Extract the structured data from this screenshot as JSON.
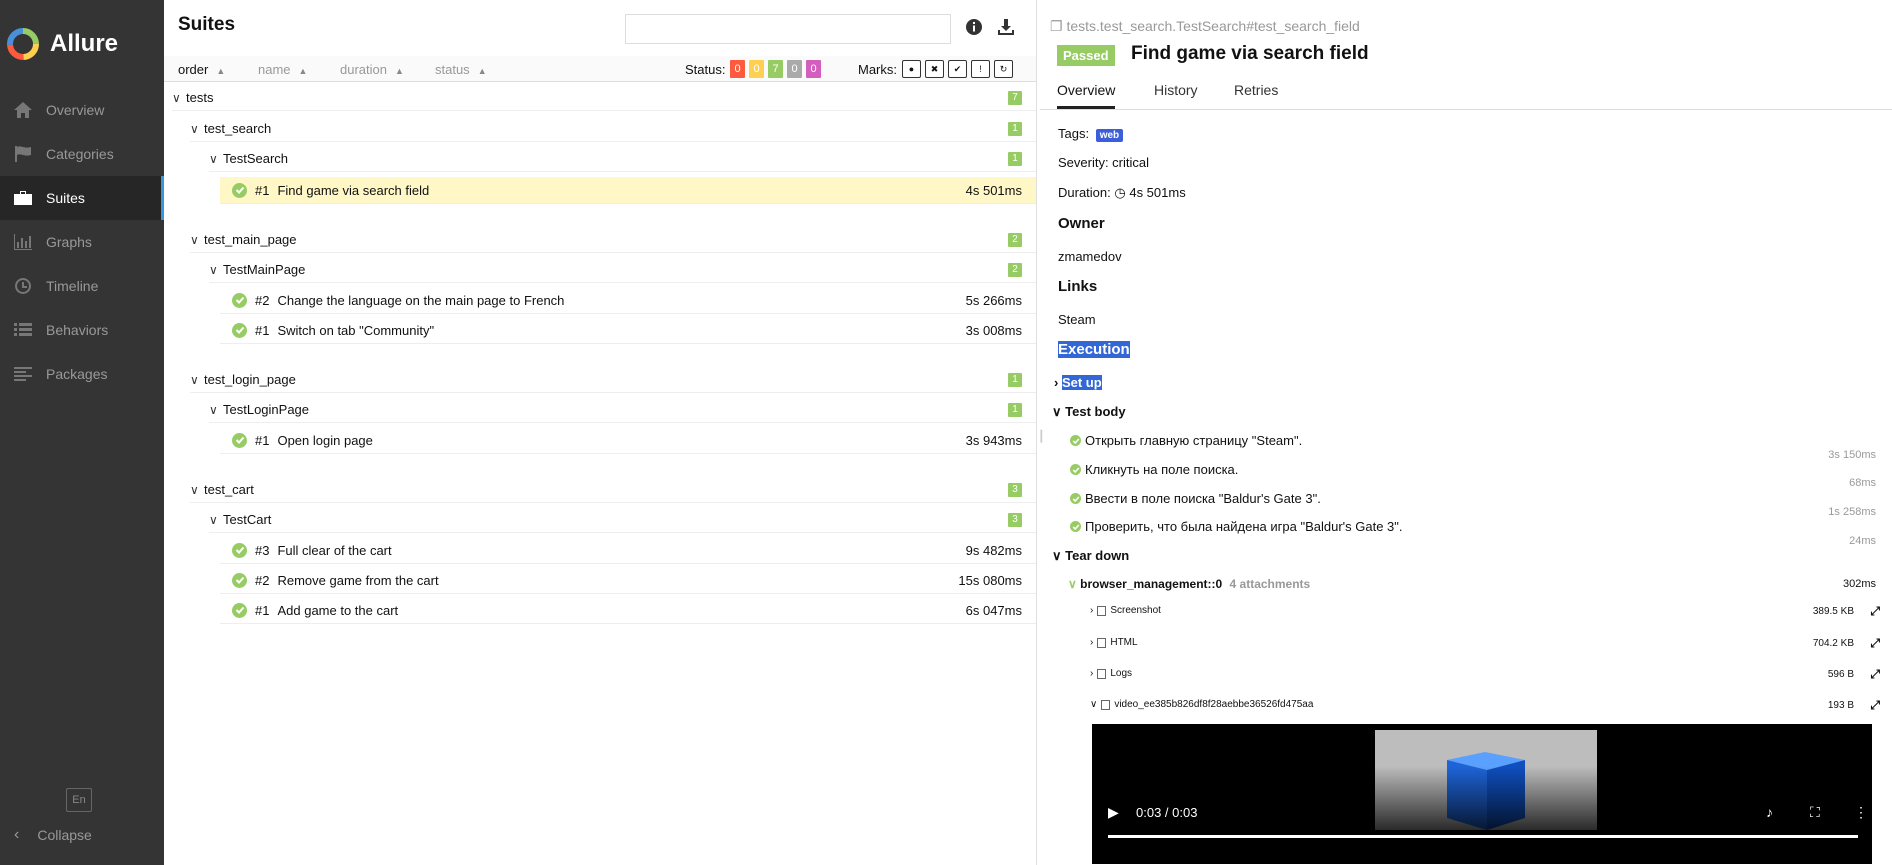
{
  "app": {
    "name": "Allure"
  },
  "sidebar": {
    "items": [
      {
        "label": "Overview",
        "icon": "home-icon"
      },
      {
        "label": "Categories",
        "icon": "flag-icon"
      },
      {
        "label": "Suites",
        "icon": "briefcase-icon",
        "active": true
      },
      {
        "label": "Graphs",
        "icon": "bar-chart-icon"
      },
      {
        "label": "Timeline",
        "icon": "clock-icon"
      },
      {
        "label": "Behaviors",
        "icon": "list-icon"
      },
      {
        "label": "Packages",
        "icon": "align-left-icon"
      }
    ],
    "language": "En",
    "collapse": "Collapse"
  },
  "suites": {
    "title": "Suites",
    "search_placeholder": "",
    "sort": [
      "order",
      "name",
      "duration",
      "status"
    ],
    "status_label": "Status:",
    "status_counts": [
      {
        "value": "0",
        "color": "#fd5a3e"
      },
      {
        "value": "0",
        "color": "#ffd050"
      },
      {
        "value": "7",
        "color": "#97cc64"
      },
      {
        "value": "0",
        "color": "#aaaaaa"
      },
      {
        "value": "0",
        "color": "#d35ebe"
      }
    ],
    "marks_label": "Marks:",
    "tree": {
      "root": {
        "label": "tests",
        "count": "7"
      },
      "suites": [
        {
          "label": "test_search",
          "count": "1",
          "class": "TestSearch",
          "class_count": "1",
          "cases": [
            {
              "num": "#1",
              "name": "Find game via search field",
              "duration": "4s 501ms"
            }
          ]
        },
        {
          "label": "test_main_page",
          "count": "2",
          "class": "TestMainPage",
          "class_count": "2",
          "cases": [
            {
              "num": "#2",
              "name": "Change the language on the main page to French",
              "duration": "5s 266ms"
            },
            {
              "num": "#1",
              "name": "Switch on tab \"Community\"",
              "duration": "3s 008ms"
            }
          ]
        },
        {
          "label": "test_login_page",
          "count": "1",
          "class": "TestLoginPage",
          "class_count": "1",
          "cases": [
            {
              "num": "#1",
              "name": "Open login page",
              "duration": "3s 943ms"
            }
          ]
        },
        {
          "label": "test_cart",
          "count": "3",
          "class": "TestCart",
          "class_count": "3",
          "cases": [
            {
              "num": "#3",
              "name": "Full clear of the cart",
              "duration": "9s 482ms"
            },
            {
              "num": "#2",
              "name": "Remove game from the cart",
              "duration": "15s 080ms"
            },
            {
              "num": "#1",
              "name": "Add game to the cart",
              "duration": "6s 047ms"
            }
          ]
        }
      ]
    }
  },
  "detail": {
    "path": "tests.test_search.TestSearch#test_search_field",
    "status": "Passed",
    "title": "Find game via search field",
    "tabs": [
      "Overview",
      "History",
      "Retries"
    ],
    "tags_label": "Tags:",
    "tag": "web",
    "severity": "Severity: critical",
    "duration_label": "Duration:",
    "duration": "4s 501ms",
    "owner_heading": "Owner",
    "owner": "zmamedov",
    "links_heading": "Links",
    "link": "Steam",
    "execution_heading": "Execution",
    "setup": "Set up",
    "test_body": "Test body",
    "steps": [
      {
        "text": "Открыть главную страницу \"Steam\".",
        "duration": "3s 150ms"
      },
      {
        "text": "Кликнуть на поле поиска.",
        "duration": "68ms"
      },
      {
        "text": "Ввести в поле поиска \"Baldur's Gate 3\".",
        "duration": "1s 258ms"
      },
      {
        "text": "Проверить, что была найдена игра \"Baldur's Gate 3\".",
        "duration": "24ms"
      }
    ],
    "teardown": "Tear down",
    "fixture": {
      "name": "browser_management::0",
      "attachments": "4 attachments",
      "duration": "302ms"
    },
    "attachments": [
      {
        "name": "Screenshot",
        "size": "389.5 KB"
      },
      {
        "name": "HTML",
        "size": "704.2 KB"
      },
      {
        "name": "Logs",
        "size": "596 B"
      },
      {
        "name": "video_ee385b826df8f28aebbe36526fd475aa",
        "size": "193 B"
      }
    ],
    "video_time": "0:03 / 0:03",
    "video_progress": 1.0
  }
}
